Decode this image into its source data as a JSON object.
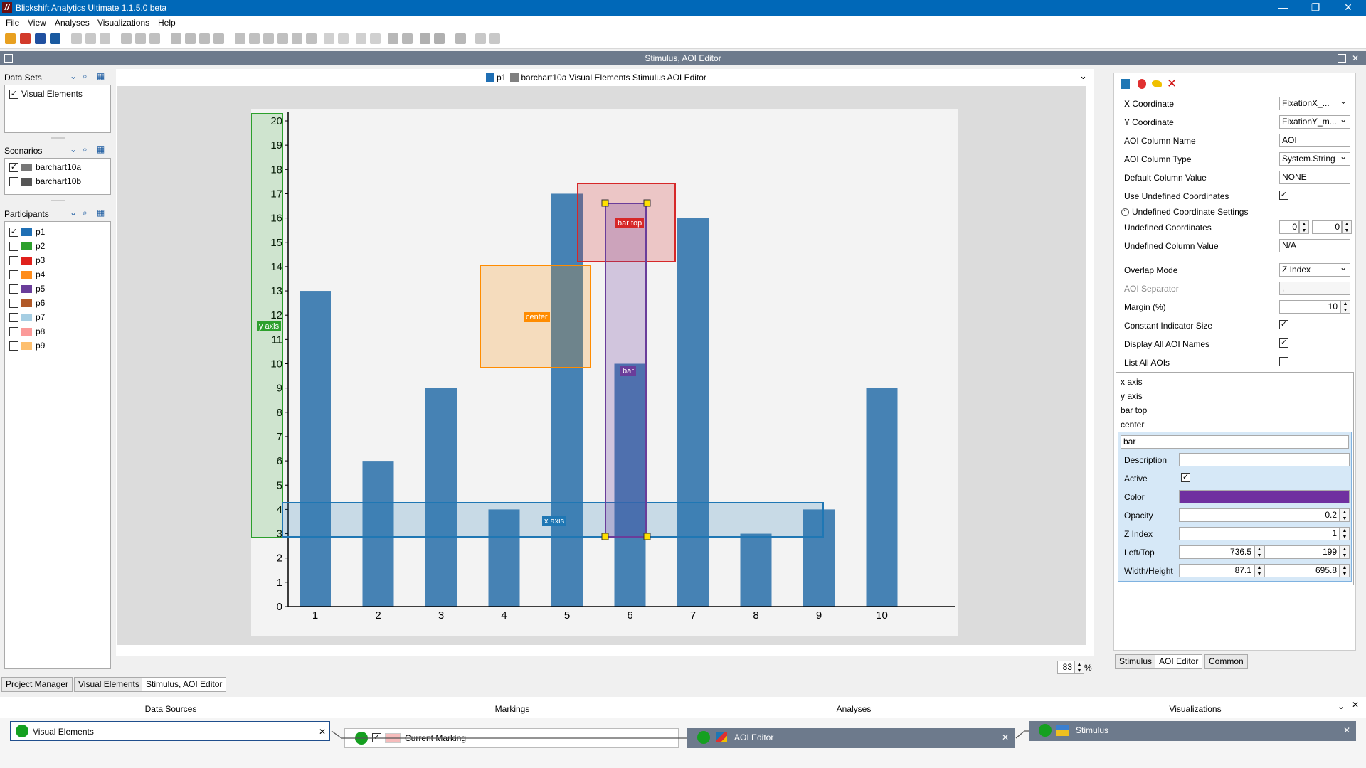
{
  "app": {
    "title": "Blickshift Analytics Ultimate 1.1.5.0 beta",
    "logo_letter": "//"
  },
  "window_controls": {
    "minimize": "—",
    "restore": "❐",
    "close": "✕"
  },
  "menu": [
    "File",
    "View",
    "Analyses",
    "Visualizations",
    "Help"
  ],
  "editor_header": "Stimulus, AOI Editor",
  "left_panel": {
    "datasets": {
      "label": "Data Sets",
      "items": [
        {
          "label": "Visual Elements",
          "checked": true
        }
      ]
    },
    "scenarios": {
      "label": "Scenarios",
      "items": [
        {
          "label": "barchart10a",
          "checked": true,
          "color": "#777777"
        },
        {
          "label": "barchart10b",
          "checked": false,
          "color": "#555555"
        }
      ]
    },
    "participants": {
      "label": "Participants",
      "items": [
        {
          "label": "p1",
          "checked": true,
          "color": "#1f6fb4"
        },
        {
          "label": "p2",
          "checked": false,
          "color": "#2ca02c"
        },
        {
          "label": "p3",
          "checked": false,
          "color": "#e0201c"
        },
        {
          "label": "p4",
          "checked": false,
          "color": "#ff8c1a"
        },
        {
          "label": "p5",
          "checked": false,
          "color": "#6a3d9a"
        },
        {
          "label": "p6",
          "checked": false,
          "color": "#b15928"
        },
        {
          "label": "p7",
          "checked": false,
          "color": "#a6cee3"
        },
        {
          "label": "p8",
          "checked": false,
          "color": "#fb9a99"
        },
        {
          "label": "p9",
          "checked": false,
          "color": "#fdbf6f"
        }
      ]
    }
  },
  "plot": {
    "legend": [
      {
        "label": "p1",
        "color": "#1f6fb4"
      },
      {
        "label": "barchart10a Visual Elements Stimulus AOI Editor",
        "color": "#808080"
      }
    ],
    "zoom": "83",
    "zoom_unit": "%"
  },
  "chart_data": {
    "type": "bar",
    "categories": [
      "1",
      "2",
      "3",
      "4",
      "5",
      "6",
      "7",
      "8",
      "9",
      "10"
    ],
    "values": [
      13,
      6,
      9,
      4,
      17,
      10,
      16,
      3,
      4,
      9
    ],
    "yticks": [
      "0",
      "1",
      "2",
      "3",
      "4",
      "5",
      "6",
      "7",
      "8",
      "9",
      "10",
      "11",
      "12",
      "13",
      "14",
      "15",
      "16",
      "17",
      "18",
      "19",
      "20"
    ],
    "ylim": [
      0,
      20
    ],
    "bar_color": "#4682b4"
  },
  "aois": [
    {
      "name": "y axis",
      "color": "#2ca02c"
    },
    {
      "name": "x axis",
      "color": "#1f77b4"
    },
    {
      "name": "center",
      "color": "#ff8c00"
    },
    {
      "name": "bar top",
      "color": "#d62728"
    },
    {
      "name": "bar",
      "color": "#6a3d9a"
    }
  ],
  "right_panel": {
    "toolbar_icons": [
      "rect-tool-icon",
      "ellipse-tool-icon",
      "polygon-tool-icon",
      "delete-icon"
    ],
    "props": {
      "x_coordinate": {
        "label": "X Coordinate",
        "value": "FixationX_..."
      },
      "y_coordinate": {
        "label": "Y Coordinate",
        "value": "FixationY_m..."
      },
      "aoi_column_name": {
        "label": "AOI Column Name",
        "value": "AOI"
      },
      "aoi_column_type": {
        "label": "AOI Column Type",
        "value": "System.String"
      },
      "default_column_value": {
        "label": "Default Column Value",
        "value": "NONE"
      },
      "use_undefined": {
        "label": "Use Undefined Coordinates",
        "checked": true
      },
      "undefined_settings": {
        "label": "Undefined Coordinate Settings"
      },
      "undefined_coords": {
        "label": "Undefined Coordinates",
        "x": "0",
        "y": "0"
      },
      "undefined_column_value": {
        "label": "Undefined Column Value",
        "value": "N/A"
      },
      "overlap_mode": {
        "label": "Overlap Mode",
        "value": "Z Index"
      },
      "aoi_separator": {
        "label": "AOI Separator",
        "value": ","
      },
      "margin": {
        "label": "Margin (%)",
        "value": "10"
      },
      "constant_indicator": {
        "label": "Constant Indicator Size",
        "checked": true
      },
      "display_all_names": {
        "label": "Display All AOI Names",
        "checked": true
      },
      "list_all_aois": {
        "label": "List All AOIs",
        "checked": false
      }
    },
    "aoi_list": [
      "x axis",
      "y axis",
      "bar top",
      "center"
    ],
    "selected": {
      "name": "bar",
      "description_label": "Description",
      "description": "",
      "active_label": "Active",
      "active": true,
      "color_label": "Color",
      "color": "#7030a0",
      "opacity_label": "Opacity",
      "opacity": "0.2",
      "zindex_label": "Z Index",
      "zindex": "1",
      "lefttop_label": "Left/Top",
      "left": "736.5",
      "top": "199",
      "wh_label": "Width/Height",
      "width": "87.1",
      "height": "695.8"
    },
    "tabs": [
      "Stimulus",
      "AOI Editor",
      "Common"
    ]
  },
  "bottom_tabs": [
    "Project Manager",
    "Visual Elements",
    "Stimulus, AOI Editor"
  ],
  "pipeline": {
    "data_sources": {
      "label": "Data Sources",
      "node": "Visual Elements"
    },
    "markings": {
      "label": "Markings",
      "node": "Current Marking"
    },
    "analyses": {
      "label": "Analyses",
      "node": "AOI Editor"
    },
    "visualizations": {
      "label": "Visualizations",
      "node": "Stimulus"
    }
  }
}
